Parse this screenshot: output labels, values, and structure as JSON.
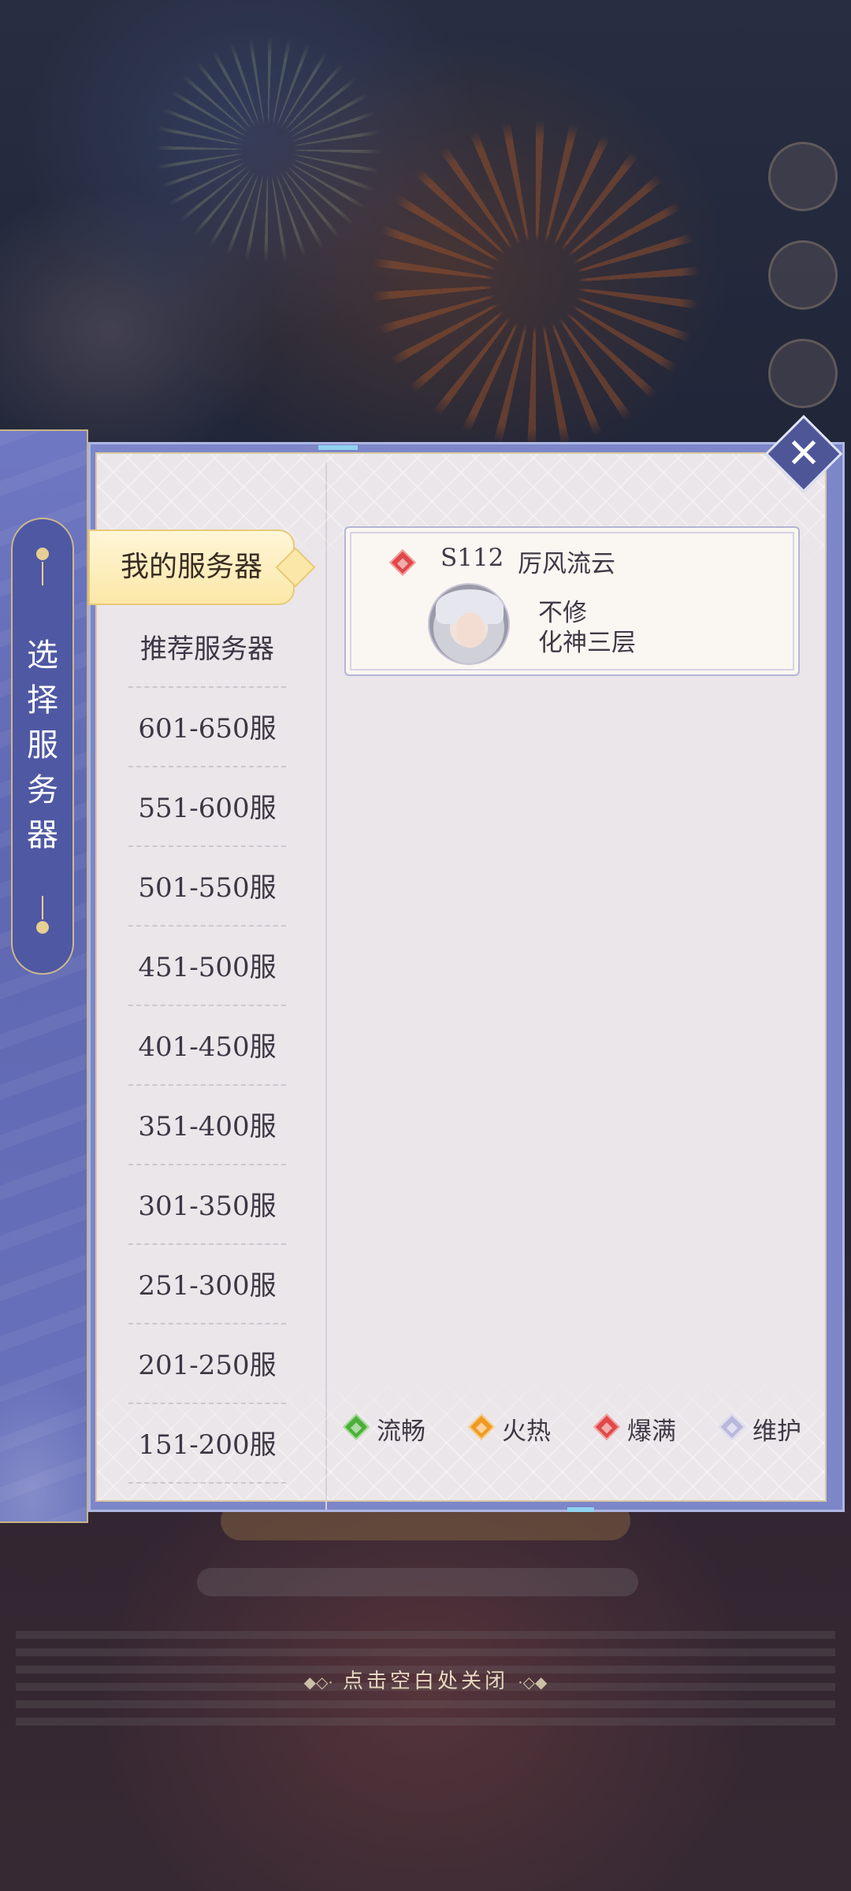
{
  "dialog": {
    "title_chars": [
      "选",
      "择",
      "服",
      "务",
      "器"
    ],
    "close_label": "✕",
    "dismiss_hint": "点击空白处关闭",
    "hint_deco_left": "◆◇·",
    "hint_deco_right": "·◇◆"
  },
  "categories": [
    {
      "label": "我的服务器",
      "selected": true
    },
    {
      "label": "推荐服务器",
      "selected": false
    },
    {
      "label": "601-650服",
      "selected": false
    },
    {
      "label": "551-600服",
      "selected": false
    },
    {
      "label": "501-550服",
      "selected": false
    },
    {
      "label": "451-500服",
      "selected": false
    },
    {
      "label": "401-450服",
      "selected": false
    },
    {
      "label": "351-400服",
      "selected": false
    },
    {
      "label": "301-350服",
      "selected": false
    },
    {
      "label": "251-300服",
      "selected": false
    },
    {
      "label": "201-250服",
      "selected": false
    },
    {
      "label": "151-200服",
      "selected": false
    }
  ],
  "my_server": {
    "id": "S112",
    "name": "厉风流云",
    "status": "爆满",
    "character_name": "不修",
    "character_level": "化神三层"
  },
  "legend": [
    {
      "label": "流畅",
      "color": "#4caf3a",
      "border": "#a9dc9a"
    },
    {
      "label": "火热",
      "color": "#f09a22",
      "border": "#f6cf8a"
    },
    {
      "label": "爆满",
      "color": "#e04848",
      "border": "#f2a1a1"
    },
    {
      "label": "维护",
      "color": "#b9b8dc",
      "border": "#dcdcf0"
    }
  ],
  "colors": {
    "panel_frame": "#7c86c8",
    "panel_body": "#ebe6ea",
    "selected_tab": "#fbe7a7",
    "gold_trim": "#cdb98d"
  }
}
